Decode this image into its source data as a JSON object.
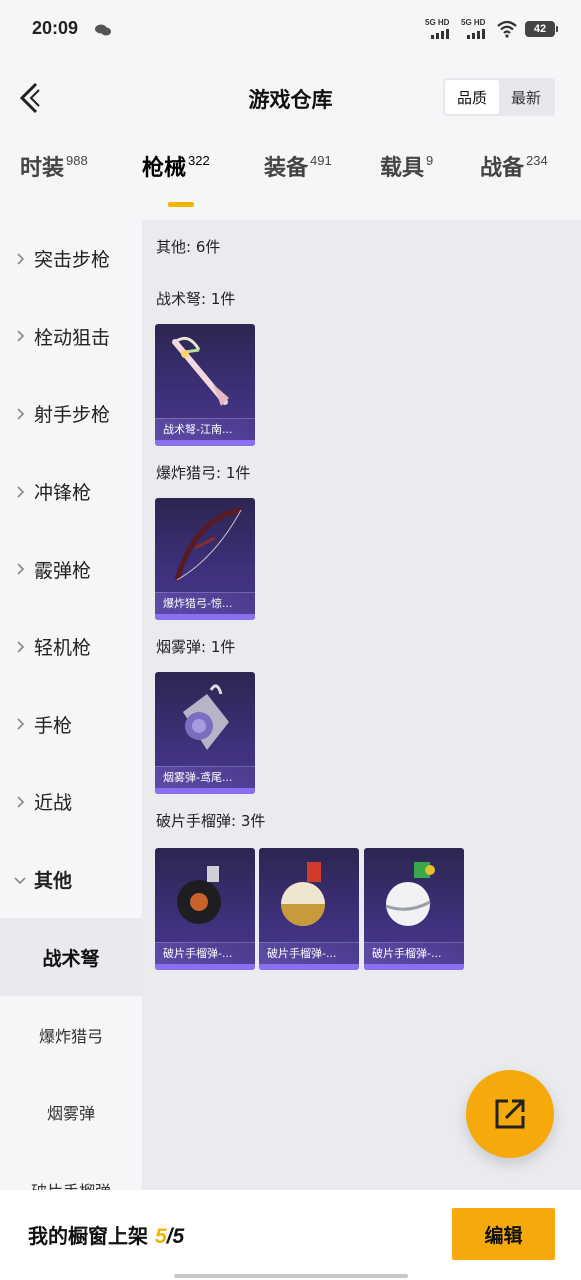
{
  "status_bar": {
    "time": "20:09",
    "sim1": "5G HD",
    "sim2": "5G HD",
    "battery": "42"
  },
  "header": {
    "title": "游戏仓库",
    "sort_options": [
      "品质",
      "最新"
    ],
    "sort_selected": "品质"
  },
  "tabs": [
    {
      "label": "时装",
      "count": "988"
    },
    {
      "label": "枪械",
      "count": "322",
      "active": true
    },
    {
      "label": "装备",
      "count": "491"
    },
    {
      "label": "载具",
      "count": "9"
    },
    {
      "label": "战备",
      "count": "234"
    }
  ],
  "sidebar": {
    "categories": [
      "突击步枪",
      "栓动狙击",
      "射手步枪",
      "冲锋枪",
      "霰弹枪",
      "轻机枪",
      "手枪",
      "近战",
      "其他"
    ],
    "expanded": "其他",
    "subcategories": [
      "战术弩",
      "爆炸猎弓",
      "烟雾弹",
      "破片手榴弹"
    ],
    "active_sub": "战术弩"
  },
  "content": {
    "summary": "其他: 6件",
    "sections": [
      {
        "title": "战术弩: 1件",
        "items": [
          {
            "name": "战术弩-江南...",
            "art": "crossbow"
          }
        ]
      },
      {
        "title": "爆炸猎弓: 1件",
        "items": [
          {
            "name": "爆炸猎弓-惊...",
            "art": "bow"
          }
        ]
      },
      {
        "title": "烟雾弹: 1件",
        "items": [
          {
            "name": "烟雾弹-鸢尾...",
            "art": "smoke"
          }
        ]
      },
      {
        "title": "破片手榴弹: 3件",
        "items": [
          {
            "name": "破片手榴弹-...",
            "art": "grenade-dark"
          },
          {
            "name": "破片手榴弹-...",
            "art": "grenade-gold"
          },
          {
            "name": "破片手榴弹-...",
            "art": "grenade-green"
          }
        ]
      }
    ]
  },
  "bottom": {
    "shop_label": "我的橱窗上架",
    "shop_count": "5",
    "shop_sep": "/",
    "shop_total": "5",
    "edit_label": "编辑"
  },
  "colors": {
    "accent": "#f6a90a",
    "card_purple": "#3d2f78",
    "card_bar": "#8a6ff0"
  },
  "icons": {
    "back": "back-arrow-icon",
    "fab": "share-external-icon",
    "chevron": "chevron-right-icon"
  }
}
